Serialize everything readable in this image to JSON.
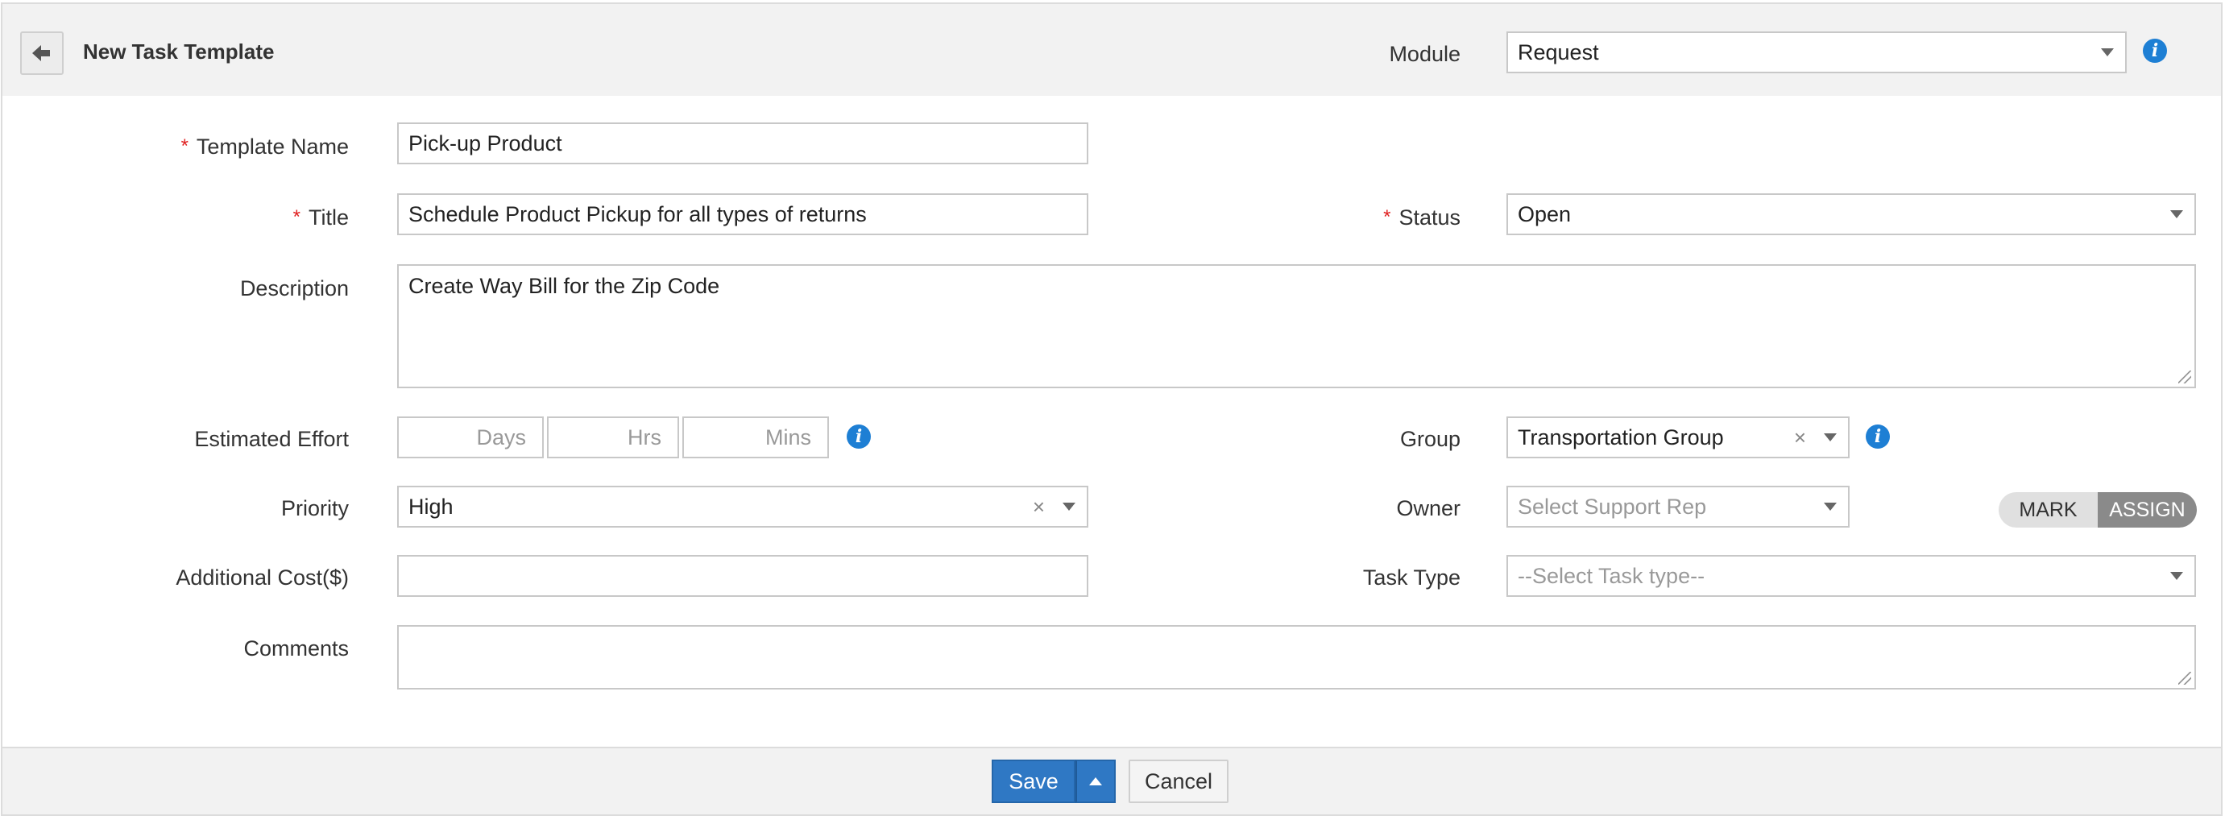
{
  "header": {
    "title": "New Task Template",
    "module_label": "Module",
    "module_value": "Request"
  },
  "form": {
    "template_name": {
      "label": "Template Name",
      "value": "Pick-up Product",
      "required": true
    },
    "title": {
      "label": "Title",
      "value": "Schedule Product Pickup for all types of returns",
      "required": true
    },
    "status": {
      "label": "Status",
      "value": "Open",
      "required": true
    },
    "description": {
      "label": "Description",
      "value": "Create Way Bill for the Zip Code"
    },
    "estimated_effort": {
      "label": "Estimated Effort",
      "days_placeholder": "Days",
      "hrs_placeholder": "Hrs",
      "mins_placeholder": "Mins"
    },
    "group": {
      "label": "Group",
      "value": "Transportation Group"
    },
    "priority": {
      "label": "Priority",
      "value": "High"
    },
    "owner": {
      "label": "Owner",
      "placeholder": "Select Support Rep",
      "toggle_mark": "MARK",
      "toggle_assign": "ASSIGN",
      "toggle_selected": "ASSIGN"
    },
    "additional_cost": {
      "label": "Additional Cost($)",
      "value": ""
    },
    "task_type": {
      "label": "Task Type",
      "placeholder": "--Select Task type--"
    },
    "comments": {
      "label": "Comments",
      "value": ""
    },
    "required_mark": "*",
    "clear_glyph": "×",
    "info_glyph": "i"
  },
  "footer": {
    "save_label": "Save",
    "cancel_label": "Cancel"
  },
  "colors": {
    "primary_button": "#2f78c4",
    "info_icon": "#1e7fd4",
    "required": "#e02020",
    "toggle_active": "#8a8a8a"
  },
  "icons": {
    "back": "back-arrow-icon",
    "info": "info-icon",
    "dropdown": "chevron-down-icon",
    "clear": "close-icon",
    "save_more": "caret-up-icon"
  }
}
